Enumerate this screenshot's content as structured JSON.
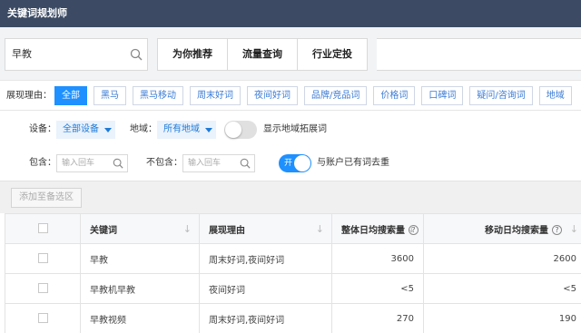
{
  "app": {
    "title": "关键词规划师"
  },
  "search": {
    "value": "早教"
  },
  "tabs": [
    "为你推荐",
    "流量查询",
    "行业定投"
  ],
  "reasons": {
    "label": "展现理由：",
    "chips": [
      "全部",
      "黑马",
      "黑马移动",
      "周末好词",
      "夜间好词",
      "品牌/竞品词",
      "价格词",
      "口碑词",
      "疑问/咨询词",
      "地域"
    ]
  },
  "filters": {
    "device_label": "设备：",
    "device_value": "全部设备",
    "region_label": "地域：",
    "region_value": "所有地域",
    "region_expand_label": "显示地域拓展词",
    "include_label": "包含：",
    "include_placeholder": "输入回车",
    "exclude_label": "不包含：",
    "exclude_placeholder": "输入回车",
    "dedupe_toggle_text": "开",
    "dedupe_label": "与账户已有词去重"
  },
  "actions": {
    "add_to_pool": "添加至备选区"
  },
  "table": {
    "columns": {
      "keyword": "关键词",
      "reason": "展现理由",
      "overall": "整体日均搜索量",
      "mobile": "移动日均搜索量"
    },
    "rows": [
      {
        "keyword": "早教",
        "reason": "周末好词,夜间好词",
        "overall": "3600",
        "mobile": "2600"
      },
      {
        "keyword": "早教机早教",
        "reason": "夜间好词",
        "overall": "<5",
        "mobile": "<5"
      },
      {
        "keyword": "早教视频",
        "reason": "周末好词,夜间好词",
        "overall": "270",
        "mobile": "190"
      }
    ]
  }
}
